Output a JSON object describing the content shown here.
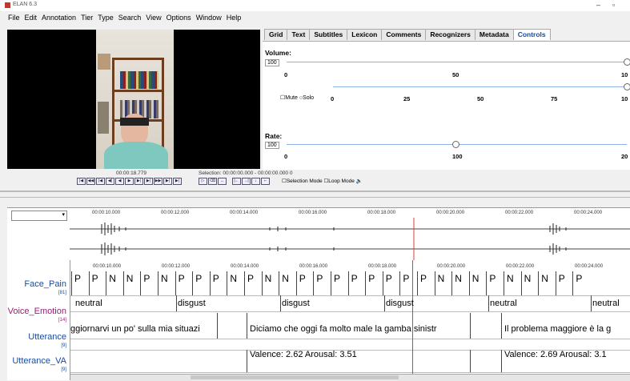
{
  "window": {
    "title": "ELAN 6.3"
  },
  "menu": [
    "File",
    "Edit",
    "Annotation",
    "Tier",
    "Type",
    "Search",
    "View",
    "Options",
    "Window",
    "Help"
  ],
  "tabs": [
    "Grid",
    "Text",
    "Subtitles",
    "Lexicon",
    "Comments",
    "Recognizers",
    "Metadata",
    "Controls"
  ],
  "active_tab": "Controls",
  "controls": {
    "volume_label": "Volume:",
    "volume_value": "100",
    "volume_ticks": [
      "0",
      "50",
      "10"
    ],
    "mute_label": "Mute",
    "solo_label": "Solo",
    "solo_ticks": [
      "0",
      "25",
      "50",
      "75",
      "10"
    ],
    "rate_label": "Rate:",
    "rate_value": "100",
    "rate_ticks": [
      "0",
      "100",
      "20"
    ]
  },
  "media": {
    "time": "00:00:18.779",
    "selection": "Selection: 00:00:00.000 - 00:00:00.000  0",
    "selection_mode": "Selection Mode",
    "loop_mode": "Loop Mode"
  },
  "timeline": {
    "ticks": [
      "00:00:10.000",
      "00:00:12.000",
      "00:00:14.000",
      "00:00:16.000",
      "00:00:18.000",
      "00:00:20.000",
      "00:00:22.000",
      "00:00:24.000"
    ]
  },
  "tiers": [
    {
      "name": "Face_Pain",
      "count": "[81]",
      "color": "#1a4ba0"
    },
    {
      "name": "Voice_Emotion",
      "count": "[14]",
      "color": "#a01a7a"
    },
    {
      "name": "Utterance",
      "count": "[9]",
      "color": "#1a4ba0"
    },
    {
      "name": "Utterance_VA",
      "count": "[9]",
      "color": "#1a4ba0"
    }
  ],
  "face_pain_cells": [
    "P",
    "P",
    "N",
    "N",
    "P",
    "N",
    "P",
    "P",
    "P",
    "N",
    "P",
    "N",
    "N",
    "P",
    "P",
    "P",
    "P",
    "P",
    "P",
    "P",
    "P",
    "N",
    "N",
    "N",
    "P",
    "N",
    "N",
    "N",
    "P",
    "P"
  ],
  "voice_emotion": [
    "neutral",
    "disgust",
    "disgust",
    "disgust",
    "neutral",
    "neutral"
  ],
  "utterance": [
    "ggiornarvi un po' sulla mia situazi",
    "Diciamo che oggi fa molto male la gamba sinistr",
    "Il problema maggiore è la g"
  ],
  "utterance_va": [
    "Valence: 2.62   Arousal: 3.51",
    "Valence: 2.69   Arousal: 3.1"
  ],
  "colors": {
    "accent": "#1a4ba0",
    "emotion": "#a01a7a",
    "cursor": "#d04040"
  }
}
